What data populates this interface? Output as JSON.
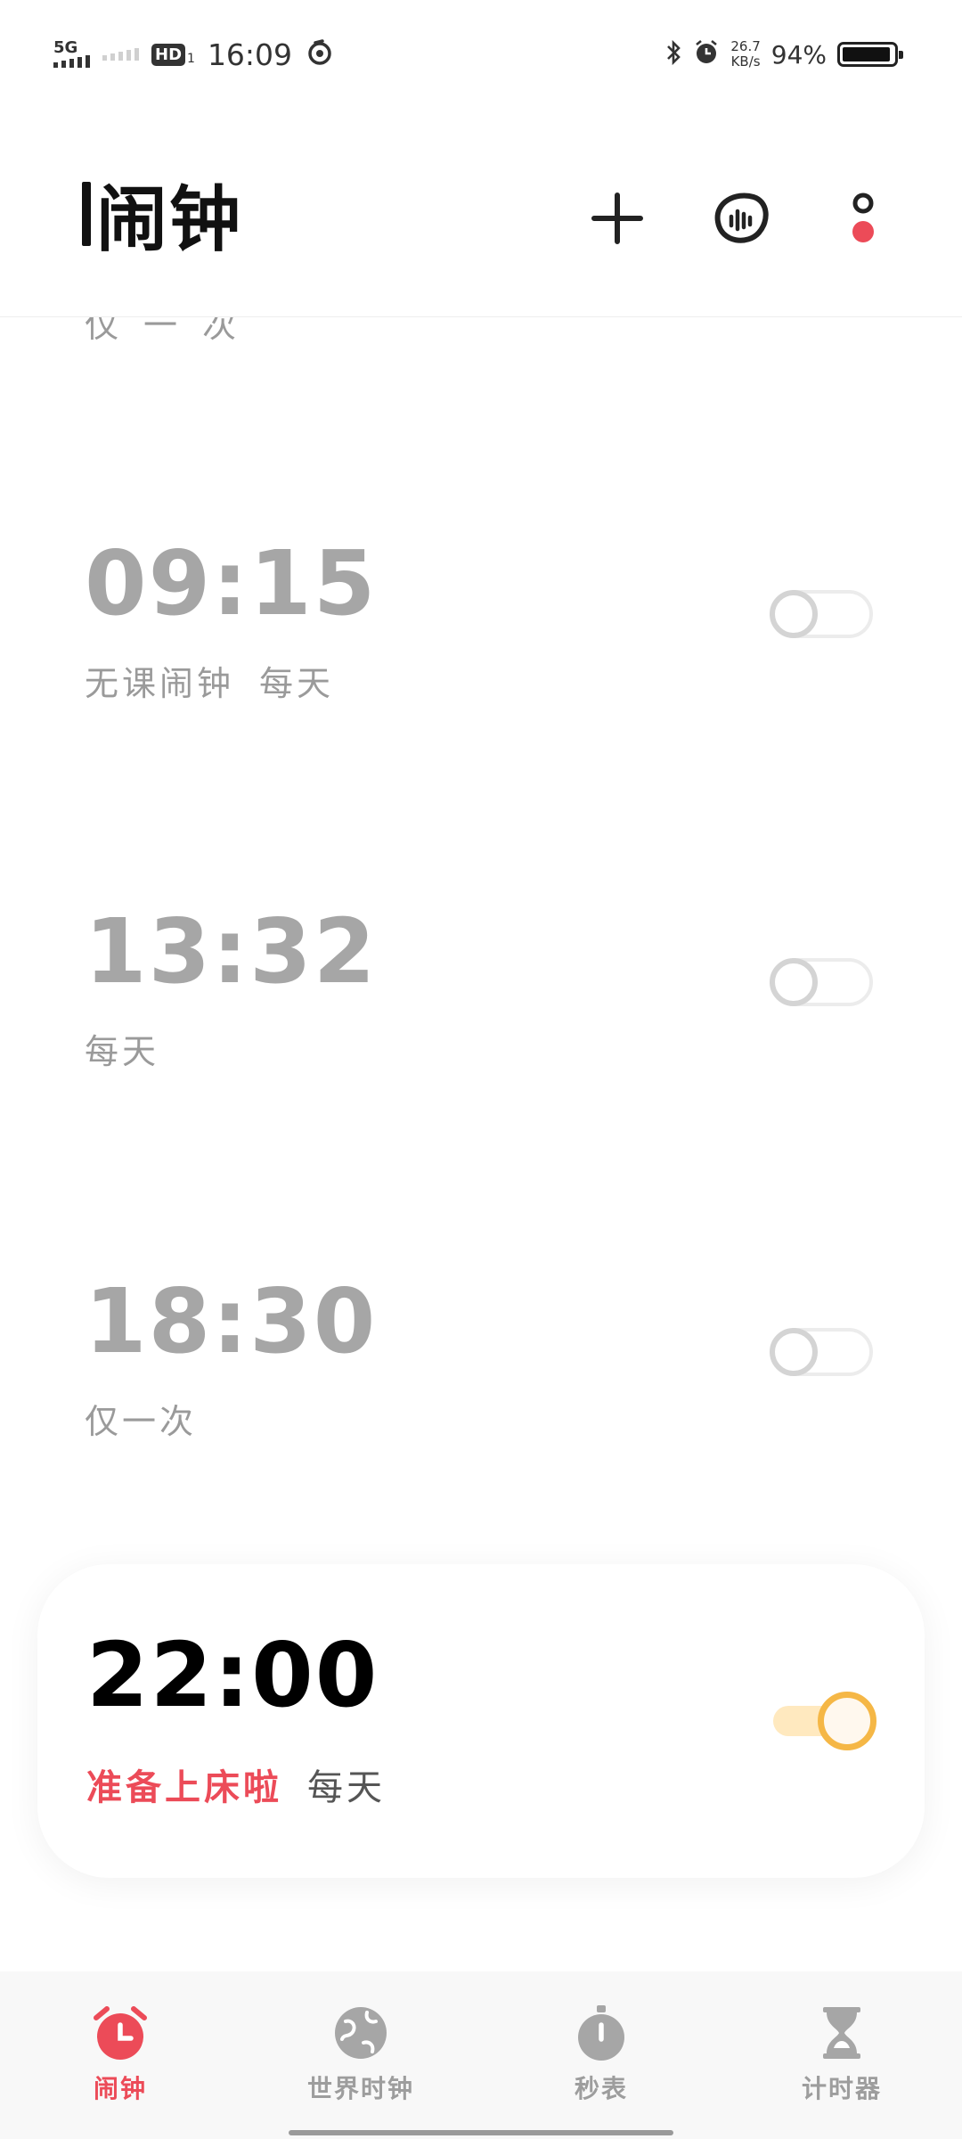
{
  "status_bar": {
    "network": "5G",
    "hd": "HD",
    "hd_sub": "1",
    "time": "16:09",
    "speed_value": "26.7",
    "speed_unit": "KB/s",
    "battery_percent": "94%",
    "battery_level": 0.94
  },
  "header": {
    "title": "闹钟",
    "icons": [
      "add-icon",
      "voice-icon",
      "more-icon"
    ],
    "accent": "#ec4b58"
  },
  "alarms": {
    "partial_label": "仅一次",
    "items": [
      {
        "time": "09:15",
        "label": "无课闹钟",
        "repeat": "每天",
        "enabled": false
      },
      {
        "time": "13:32",
        "label": "",
        "repeat": "每天",
        "enabled": false
      },
      {
        "time": "18:30",
        "label": "",
        "repeat": "仅一次",
        "enabled": false
      }
    ],
    "highlighted": {
      "time": "22:00",
      "label": "准备上床啦",
      "repeat": "每天",
      "enabled": true
    }
  },
  "tabs": [
    {
      "label": "闹钟",
      "icon": "alarm-clock-icon",
      "active": true
    },
    {
      "label": "世界时钟",
      "icon": "globe-icon",
      "active": false
    },
    {
      "label": "秒表",
      "icon": "stopwatch-icon",
      "active": false
    },
    {
      "label": "计时器",
      "icon": "hourglass-icon",
      "active": false
    }
  ],
  "colors": {
    "accent_red": "#ec4b58",
    "toggle_on": "#f5b746",
    "inactive_text": "#a6a6a6"
  }
}
